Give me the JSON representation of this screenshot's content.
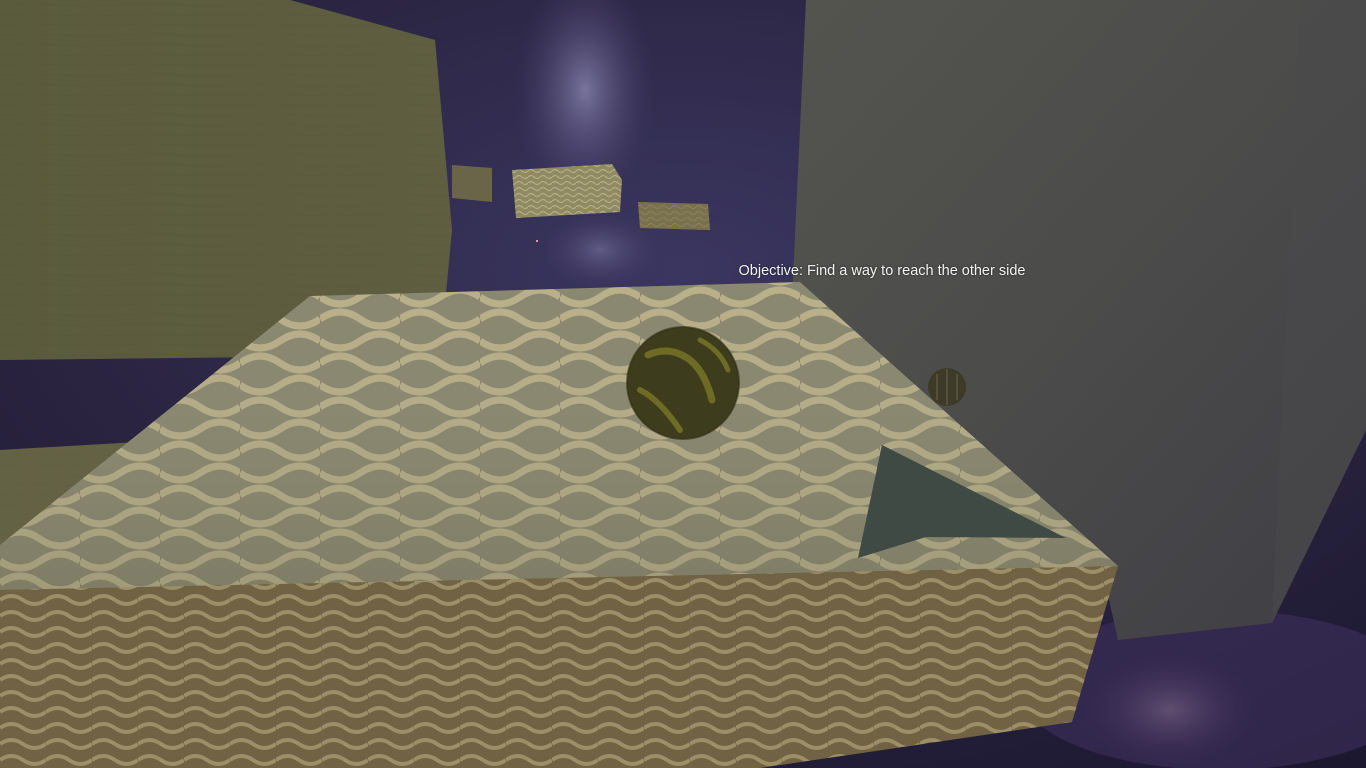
{
  "hud": {
    "objective_text": "Objective: Find a way to reach the other side"
  },
  "scene": {
    "sky_color": "#2b2343",
    "nebula_color": "#4a3f6e",
    "wall_color": "#5a5a3c",
    "platform_color": "#8c8a72",
    "platform_pattern_color": "#b3ab86",
    "ball_color": "#3f3f1e",
    "ball_stripe_color": "#6c6a22",
    "arrow_color": "#3e4a43",
    "fog_wall_color": "#525250"
  }
}
